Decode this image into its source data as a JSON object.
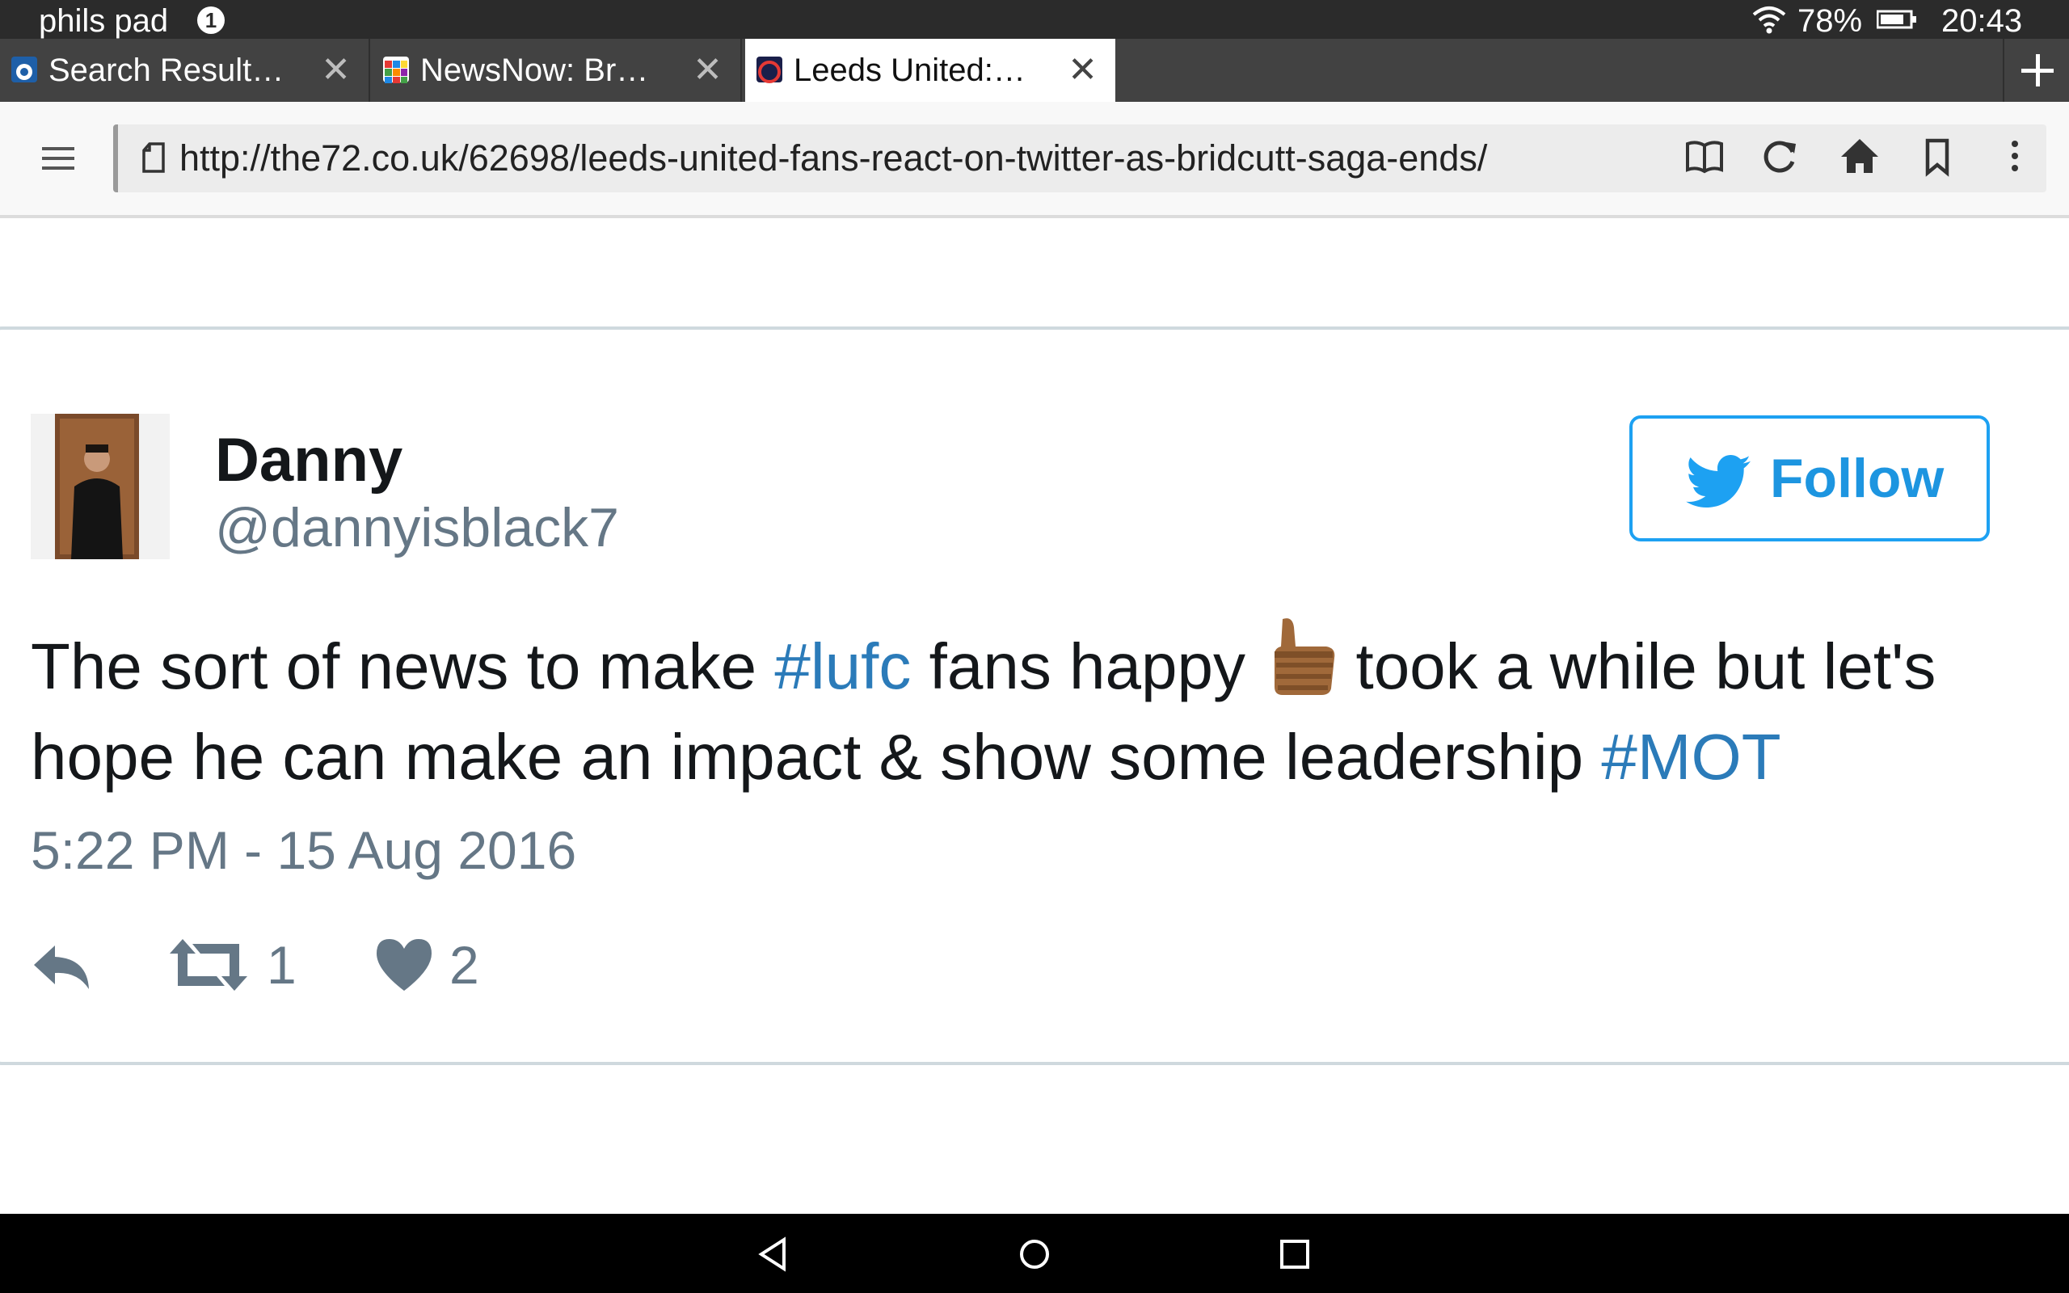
{
  "status_bar": {
    "owner": "phils pad",
    "notification_count": "1",
    "battery": "78%",
    "time": "20:43"
  },
  "tabs": [
    {
      "title": "Search Result…",
      "active": false
    },
    {
      "title": "NewsNow: Br…",
      "active": false
    },
    {
      "title": "Leeds United:…",
      "active": true
    }
  ],
  "toolbar": {
    "url": "http://the72.co.uk/62698/leeds-united-fans-react-on-twitter-as-bridcutt-saga-ends/"
  },
  "tweet": {
    "display_name": "Danny",
    "handle": "@dannyisblack7",
    "follow_label": "Follow",
    "text": {
      "part1": "The sort of news to make ",
      "hashtag1": "#lufc",
      "part2": " fans happy ",
      "part3": " took a while but let's hope he can make an impact & show some leadership ",
      "hashtag2": "#MOT"
    },
    "timestamp": "5:22 PM - 15 Aug 2016",
    "retweets": "1",
    "likes": "2"
  },
  "colors": {
    "twitter_blue": "#1da1f2",
    "hashtag": "#2b7bb9",
    "muted": "#657786"
  }
}
